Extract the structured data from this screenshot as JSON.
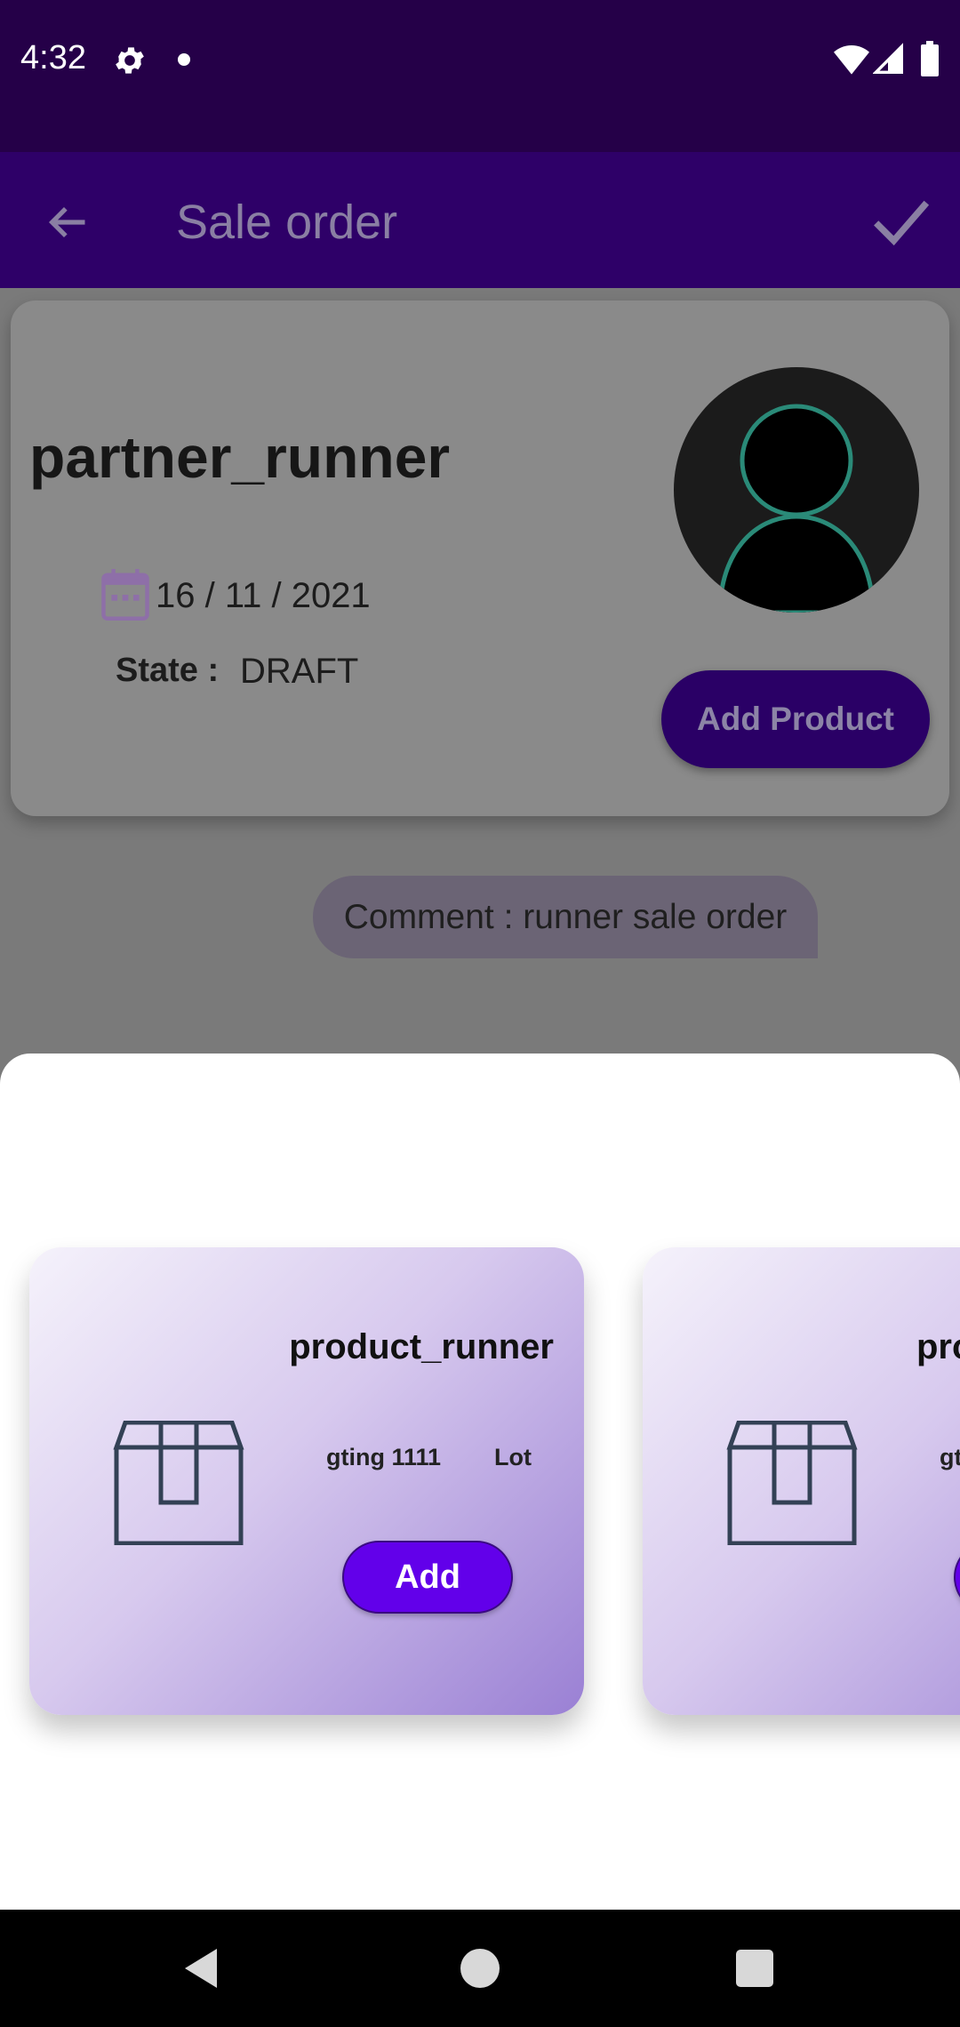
{
  "status_bar": {
    "time": "4:32"
  },
  "app_bar": {
    "title": "Sale order",
    "back_icon": "arrow-back-icon",
    "confirm_icon": "check-icon"
  },
  "partner": {
    "name": "partner_runner",
    "date": "16 / 11 / 2021",
    "state_label": "State :",
    "state_value": "DRAFT",
    "add_product_label": "Add Product"
  },
  "comment": {
    "text": "Comment : runner sale order"
  },
  "products": [
    {
      "name": "product_runner",
      "ref": "gting 1111",
      "lot": "Lot",
      "add_label": "Add"
    },
    {
      "name": "pro",
      "ref": "gt",
      "lot": "",
      "add_label": ""
    }
  ],
  "colors": {
    "status_bar": "#250048",
    "app_bar": "#2e0068",
    "accent": "#6200ea",
    "overlay_bg": "#7a7a7a"
  }
}
